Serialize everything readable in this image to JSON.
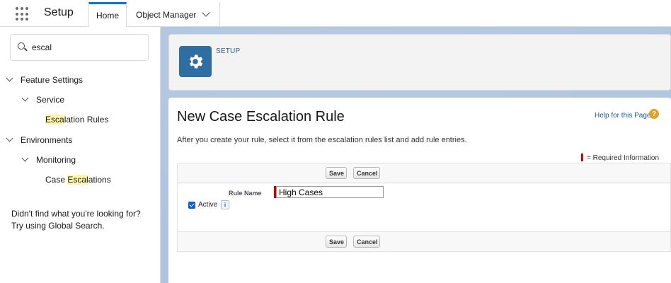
{
  "app": {
    "name": "Setup",
    "icon": "app-launcher-grid-icon"
  },
  "tabs": [
    {
      "label": "Home",
      "active": true
    },
    {
      "label": "Object Manager",
      "icon": "chevron-down-icon"
    }
  ],
  "sidebar": {
    "search": {
      "value": "escal",
      "icon": "search-icon"
    },
    "tree": [
      {
        "label": "Feature Settings",
        "expanded": true
      },
      {
        "label": "Service",
        "expanded": true
      },
      {
        "label_parts": [
          "Esca",
          "lation Rules"
        ]
      },
      {
        "label": "Environments",
        "expanded": true
      },
      {
        "label": "Monitoring",
        "expanded": true
      },
      {
        "label_parts": [
          "Case ",
          "Escal",
          "ations"
        ]
      }
    ],
    "help_lines": [
      "Didn't find what you're looking for?",
      "Try using Global Search."
    ]
  },
  "header": {
    "breadcrumb": "SETUP",
    "icon": "gear-icon"
  },
  "page": {
    "title": "New Case Escalation Rule",
    "help_link": "Help for this Page",
    "help_icon": "?",
    "instructions": "After you create your rule, select it from the escalation rules list and add rule entries.",
    "required_info": "= Required Information"
  },
  "form": {
    "save_label": "Save",
    "cancel_label": "Cancel",
    "rule_name_label": "Rule Name",
    "rule_name_value": "High Cases",
    "active_label": "Active",
    "active_checked": true,
    "info_icon": "i"
  },
  "colors": {
    "accent": "#0176d3",
    "gear_tile": "#2e6ea3",
    "required": "#cc0000",
    "highlight": "#fff6a8",
    "help_icon": "#e5a12a"
  }
}
